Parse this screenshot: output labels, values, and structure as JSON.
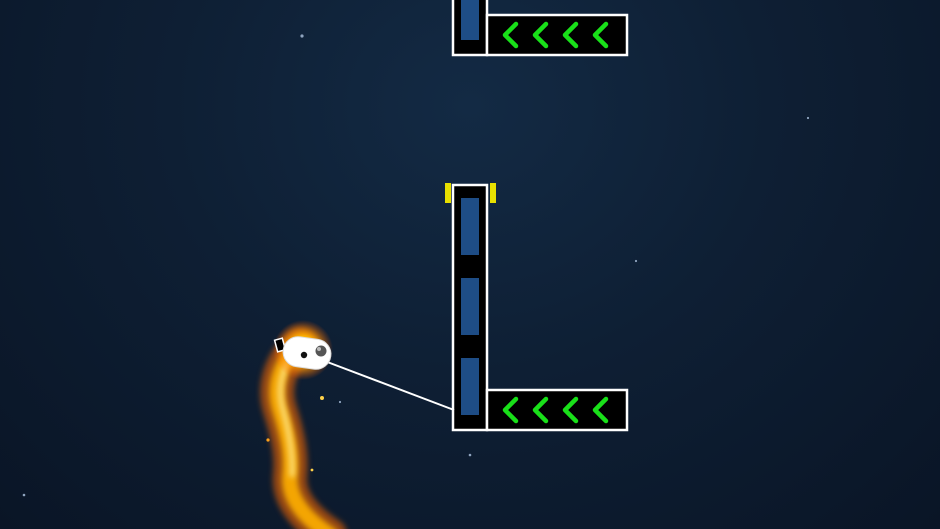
{
  "scene": {
    "background": "#0e1f34",
    "accent": {
      "conveyor_arrow": "#19e019",
      "post_cap": "#e8e000",
      "block_fill": "#1e4d86",
      "frame": "#ffffff"
    },
    "obstacles": [
      {
        "id": "top-l-block",
        "arrows": "<<<<"
      },
      {
        "id": "main-l-block",
        "arrows": "<<<<"
      }
    ],
    "player": {
      "icon": "rocket-robot-icon",
      "trail": "fire-trail"
    },
    "tether": {
      "icon": "grapple-line"
    }
  }
}
